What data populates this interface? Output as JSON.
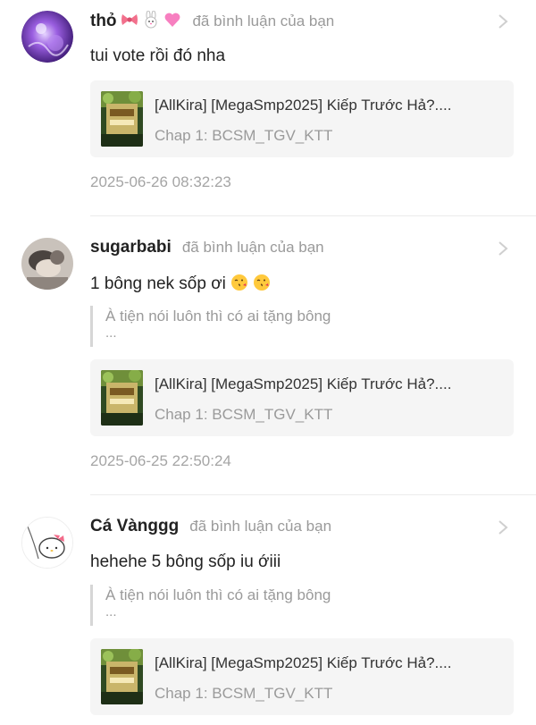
{
  "notifications": [
    {
      "username": "thỏ",
      "username_emojis": [
        "bow-emoji",
        "rabbit-emoji",
        "pink-heart-emoji"
      ],
      "action": "đã bình luận của bạn",
      "message": "tui vote rồi đó nha",
      "message_emojis": [],
      "quote": null,
      "story_title": "[AllKira] [MegaSmp2025] Kiếp Trước Hả?....",
      "chapter": "Chap 1: BCSM_TGV_KTT",
      "timestamp": "2025-06-26 08:32:23"
    },
    {
      "username": "sugarbabi",
      "username_emojis": [],
      "action": "đã bình luận của bạn",
      "message": "1 bông nek sốp ơi",
      "message_emojis": [
        "kissing-face-emoji",
        "kissing-face-emoji"
      ],
      "quote": {
        "text": "À tiện nói luôn thì có ai tặng bông",
        "more": "..."
      },
      "story_title": "[AllKira] [MegaSmp2025] Kiếp Trước Hả?....",
      "chapter": "Chap 1: BCSM_TGV_KTT",
      "timestamp": "2025-06-25 22:50:24"
    },
    {
      "username": "Cá Vànggg",
      "username_emojis": [],
      "action": "đã bình luận của bạn",
      "message": "hehehe 5 bông sốp iu ớiii",
      "message_emojis": [],
      "quote": {
        "text": "À tiện nói luôn thì có ai tặng bông",
        "more": "..."
      },
      "story_title": "[AllKira] [MegaSmp2025] Kiếp Trước Hả?....",
      "chapter": "Chap 1: BCSM_TGV_KTT",
      "timestamp": ""
    }
  ],
  "colors": {
    "username": "#222222",
    "secondary_text": "#9a9a9a",
    "card_background": "#f5f5f5",
    "divider": "#ebebeb"
  }
}
